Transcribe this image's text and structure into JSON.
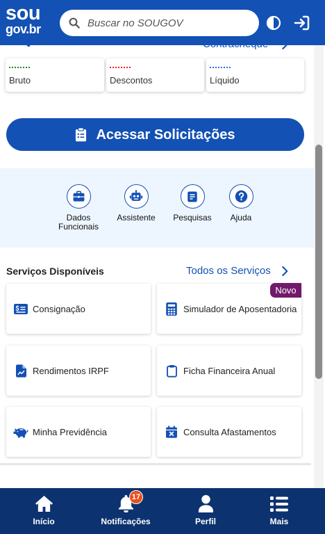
{
  "colors": {
    "primary": "#1351b4",
    "header_bg": "#1351b4",
    "nav_bg": "#0c326f",
    "band_bg": "#edf5ff",
    "novo_badge": "#71196b",
    "notification_badge": "#e8501c"
  },
  "header": {
    "logo_top": "sou",
    "logo_bottom": "gov.br",
    "search_placeholder": "Buscar no SOUGOV",
    "icons": [
      "search-icon",
      "contrast-icon",
      "sign-in-icon"
    ]
  },
  "payslip": {
    "link_label": "Contracheque",
    "icon": "search-dollar-icon",
    "cards": [
      {
        "label": "Bruto",
        "line_color": "#168821"
      },
      {
        "label": "Descontos",
        "line_color": "#e52207"
      },
      {
        "label": "Líquido",
        "line_color": "#2670e8"
      }
    ]
  },
  "primary_action": {
    "label": "Acessar Solicitações",
    "icon": "clipboard-list-icon"
  },
  "quick_links": [
    {
      "label": "Dados Funcionais",
      "icon": "briefcase-icon"
    },
    {
      "label": "Assistente",
      "icon": "robot-icon"
    },
    {
      "label": "Pesquisas",
      "icon": "survey-icon"
    },
    {
      "label": "Ajuda",
      "icon": "question-icon"
    }
  ],
  "services": {
    "title": "Serviços Disponíveis",
    "all_label": "Todos os Serviços",
    "items": [
      {
        "label": "Consignação",
        "icon": "money-icon"
      },
      {
        "label": "Simulador de Aposentadoria",
        "icon": "calculator-icon",
        "badge": "Novo"
      },
      {
        "label": "Rendimentos IRPF",
        "icon": "file-chart-icon"
      },
      {
        "label": "Ficha Financeira Anual",
        "icon": "clipboard-icon"
      },
      {
        "label": "Minha Previdência",
        "icon": "piggy-bank-icon"
      },
      {
        "label": "Consulta Afastamentos",
        "icon": "calendar-x-icon"
      }
    ]
  },
  "bottom_nav": [
    {
      "label": "Início",
      "icon": "home-icon"
    },
    {
      "label": "Notificações",
      "icon": "bell-icon",
      "badge": "17"
    },
    {
      "label": "Perfil",
      "icon": "user-icon"
    },
    {
      "label": "Mais",
      "icon": "menu-icon"
    }
  ]
}
